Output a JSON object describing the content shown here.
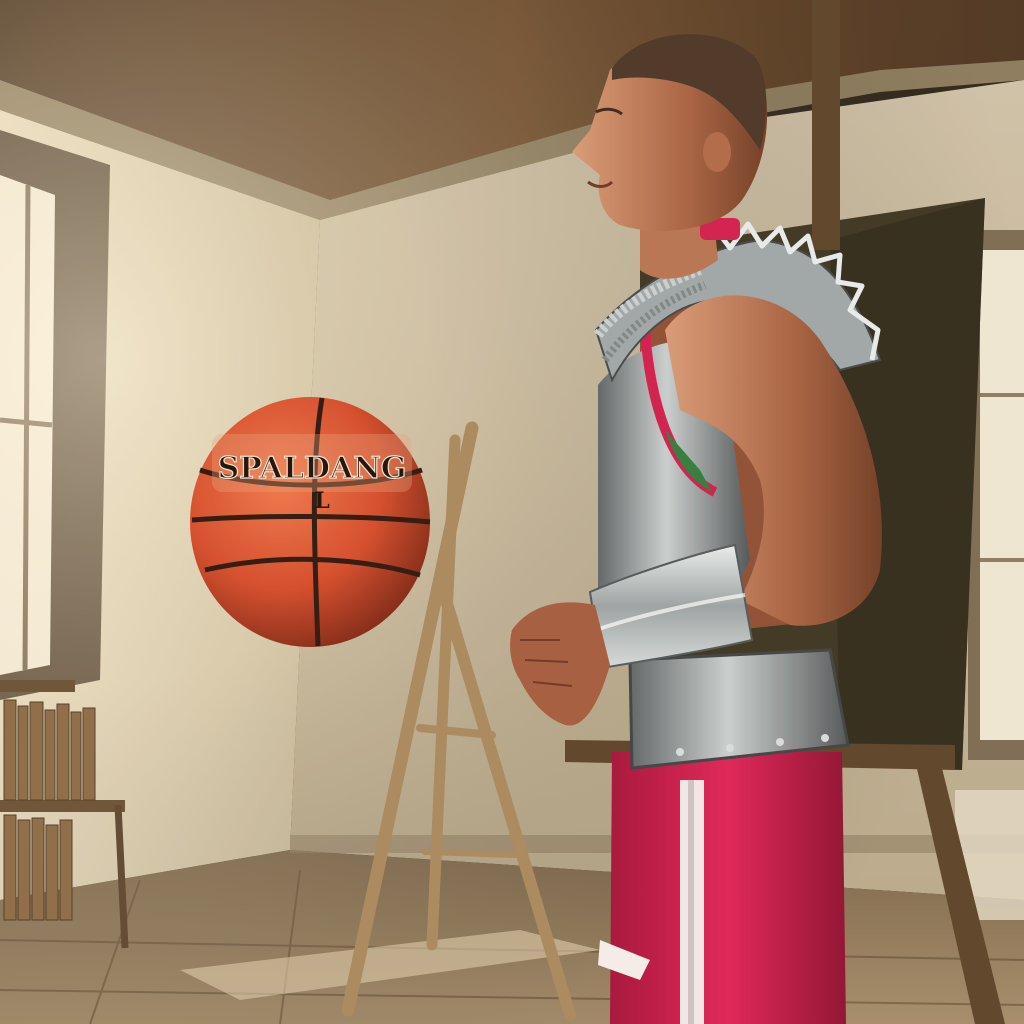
{
  "scene": {
    "ball_brand": "SPALDANG",
    "ball_mark": "L"
  },
  "colors": {
    "ceiling": "#5a3b22",
    "wall": "#d9cdb8",
    "floor": "#8a7358",
    "ball": "#d8542f",
    "shorts": "#d7184e",
    "armor": "#9aa0a4",
    "skin": "#b36a4a"
  }
}
